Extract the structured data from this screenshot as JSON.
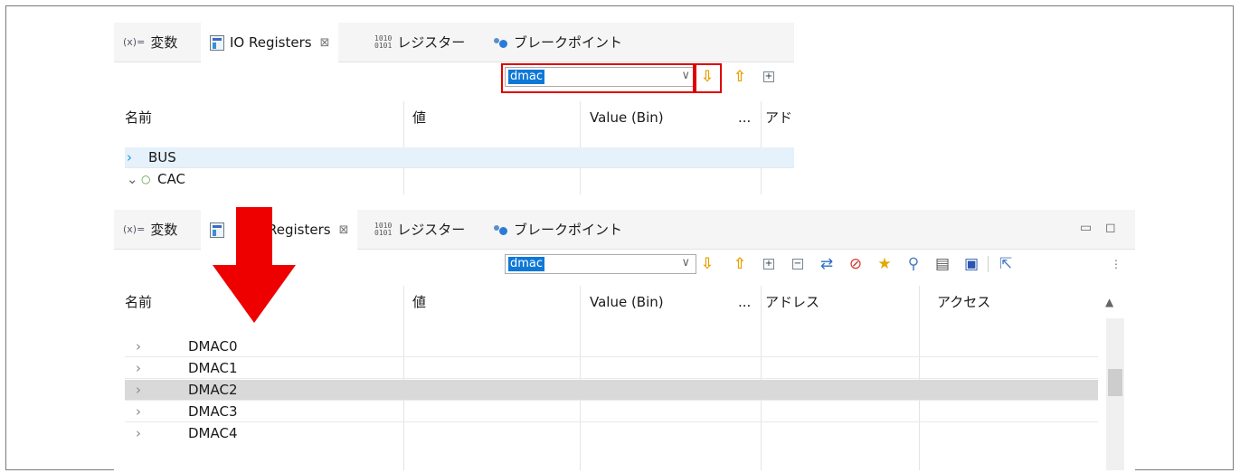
{
  "tabs": [
    {
      "label": "変数",
      "icon": "variables-icon",
      "icon_text": "(x)="
    },
    {
      "label": "IO Registers",
      "icon": "io-registers-icon"
    },
    {
      "label": "レジスター",
      "icon": "registers-icon",
      "icon_text": "1010 0101"
    },
    {
      "label": "ブレークポイント",
      "icon": "breakpoints-icon"
    }
  ],
  "top_panel": {
    "tab_partial_label": "IO Registers",
    "search_value": "dmac",
    "columns": [
      "名前",
      "値",
      "Value (Bin)",
      "...",
      "アド"
    ],
    "rows": [
      {
        "name": "BUS",
        "expanded": false,
        "highlight": true
      },
      {
        "name": "CAC",
        "expanded": true,
        "highlight": false
      }
    ]
  },
  "bottom_panel": {
    "tab_partial_label": "Registers",
    "search_value": "dmac",
    "columns": [
      "名前",
      "値",
      "Value (Bin)",
      "...",
      "アドレス",
      "アクセス"
    ],
    "rows": [
      {
        "name": "DMAC0",
        "selected": false
      },
      {
        "name": "DMAC1",
        "selected": false
      },
      {
        "name": "DMAC2",
        "selected": true
      },
      {
        "name": "DMAC3",
        "selected": false
      },
      {
        "name": "DMAC4",
        "selected": false
      }
    ]
  },
  "colors": {
    "highlight_red": "#e00000",
    "arrow_red": "#ee0000",
    "search_selection": "#0f78d7",
    "selected_row": "#d9d9d9",
    "hover_row": "#e5f1fb",
    "arrow_orange": "#e8a000"
  },
  "icons": {
    "find_next": "down-arrow-icon",
    "find_prev": "up-arrow-icon",
    "expand_all": "expand-all-icon",
    "collapse_all": "collapse-all-icon",
    "refresh": "refresh-icon",
    "disable": "disable-icon",
    "favorite": "favorite-icon",
    "search": "magnifier-icon",
    "print": "print-icon",
    "save": "save-icon",
    "export": "export-icon",
    "menu": "view-menu-icon",
    "minimize": "minimize-icon",
    "maximize": "maximize-icon"
  }
}
